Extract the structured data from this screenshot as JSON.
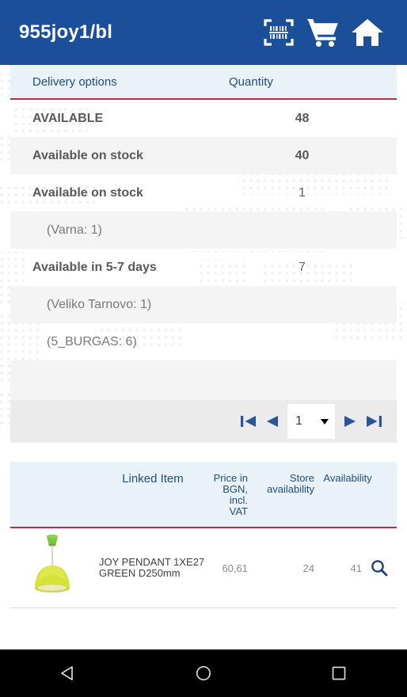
{
  "appbar": {
    "title": "955joy1/bl",
    "icons": [
      {
        "name": "barcode-scan-icon",
        "label": "Scan barcode"
      },
      {
        "name": "cart-icon",
        "label": "Cart"
      },
      {
        "name": "home-icon",
        "label": "Home"
      }
    ],
    "background": "#1b4f99"
  },
  "delivery_table": {
    "headers": {
      "options": "Delivery options",
      "quantity": "Quantity"
    },
    "accent_underline": "#b03046",
    "header_bg": "#eaf2f9",
    "rows": [
      {
        "label": "AVAILABLE",
        "qty": "48",
        "style": "bold",
        "alt": false
      },
      {
        "label": "Available on stock",
        "qty": "40",
        "style": "bold",
        "alt": true
      },
      {
        "label": "Available on stock",
        "qty": "1",
        "style": "bold",
        "alt": false
      },
      {
        "label": "(Varna: 1)",
        "qty": "",
        "style": "sub",
        "alt": true
      },
      {
        "label": "Available in 5-7 days",
        "qty": "7",
        "style": "bold",
        "alt": false
      },
      {
        "label": "(Veliko Tarnovo: 1)",
        "qty": "",
        "style": "sub",
        "alt": true
      },
      {
        "label": "(5_BURGAS: 6)",
        "qty": "",
        "style": "sub",
        "alt": false
      },
      {
        "label": "",
        "qty": "",
        "style": "empty",
        "alt": true
      }
    ],
    "pagination": {
      "first_label": "First page",
      "prev_label": "Previous page",
      "page_value": "1",
      "next_label": "Next page",
      "last_label": "Last page",
      "arrow_color": "#2a5599"
    }
  },
  "linked_items_table": {
    "headers": {
      "image": "",
      "name": "Linked Item",
      "price": "Price in BGN, incl. VAT",
      "store": "Store availability",
      "availability": "Availability"
    },
    "rows": [
      {
        "image_name": "joy-pendant-lamp-thumbnail",
        "name": "JOY PENDANT 1XE27 GREEN D250mm",
        "price": "60,61",
        "store": "24",
        "availability": "41",
        "action_icon": "search-icon"
      }
    ]
  },
  "navbar": {
    "items": [
      {
        "name": "android-back-button",
        "label": "Back"
      },
      {
        "name": "android-home-button",
        "label": "Home"
      },
      {
        "name": "android-recents-button",
        "label": "Recents"
      }
    ]
  }
}
